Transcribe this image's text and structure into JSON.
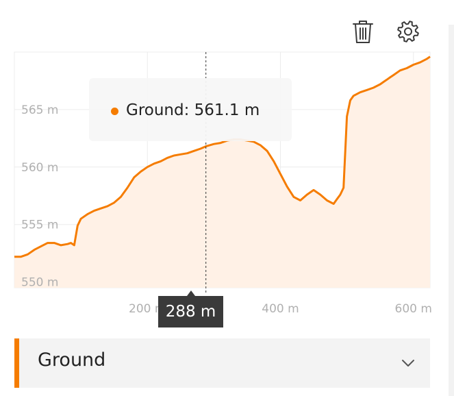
{
  "toolbar": {
    "delete_icon": "trash-icon",
    "settings_icon": "gear-icon"
  },
  "tooltip": {
    "text": "Ground: 561.1 m"
  },
  "crosshair": {
    "x_label": "288 m",
    "x": 288
  },
  "series_selector": {
    "selected": "Ground",
    "icon": "chevron-down-icon"
  },
  "colors": {
    "accent": "#f57c00",
    "fill": "#fff1e6",
    "grid": "#ececec"
  },
  "chart_data": {
    "type": "area",
    "xlabel": "",
    "ylabel": "",
    "xlim": [
      0,
      625
    ],
    "ylim": [
      549.5,
      570
    ],
    "x_ticks": [
      200,
      400,
      600
    ],
    "x_tick_labels": [
      "200 m",
      "400 m",
      "600 m"
    ],
    "y_ticks": [
      550,
      555,
      560,
      565
    ],
    "y_tick_labels": [
      "550 m",
      "555 m",
      "560 m",
      "565 m"
    ],
    "grid": true,
    "series": [
      {
        "name": "Ground",
        "x": [
          0,
          10,
          20,
          30,
          40,
          50,
          60,
          70,
          80,
          85,
          90,
          95,
          100,
          110,
          120,
          130,
          140,
          150,
          160,
          170,
          180,
          190,
          200,
          210,
          220,
          230,
          240,
          250,
          260,
          270,
          280,
          288,
          300,
          310,
          320,
          330,
          340,
          350,
          360,
          370,
          380,
          390,
          400,
          410,
          420,
          430,
          440,
          450,
          460,
          470,
          480,
          485,
          490,
          495,
          500,
          505,
          510,
          520,
          530,
          540,
          550,
          555,
          560,
          565,
          570,
          580,
          590,
          600,
          610,
          620,
          625
        ],
        "y": [
          552.2,
          552.2,
          552.4,
          552.8,
          553.1,
          553.4,
          553.4,
          553.2,
          553.3,
          553.4,
          553.2,
          554.9,
          555.5,
          555.9,
          556.2,
          556.4,
          556.6,
          556.9,
          557.4,
          558.2,
          559.1,
          559.6,
          560.0,
          560.3,
          560.5,
          560.8,
          561.0,
          561.1,
          561.2,
          561.4,
          561.6,
          561.8,
          562.0,
          562.1,
          562.3,
          562.4,
          562.4,
          562.3,
          562.2,
          561.9,
          561.4,
          560.5,
          559.4,
          558.3,
          557.4,
          557.1,
          557.6,
          558.0,
          557.6,
          557.1,
          556.8,
          557.2,
          557.6,
          558.2,
          564.4,
          565.8,
          566.2,
          566.5,
          566.7,
          566.9,
          567.2,
          567.4,
          567.6,
          567.8,
          568.0,
          568.4,
          568.6,
          568.9,
          569.1,
          569.4,
          569.6
        ]
      }
    ]
  }
}
